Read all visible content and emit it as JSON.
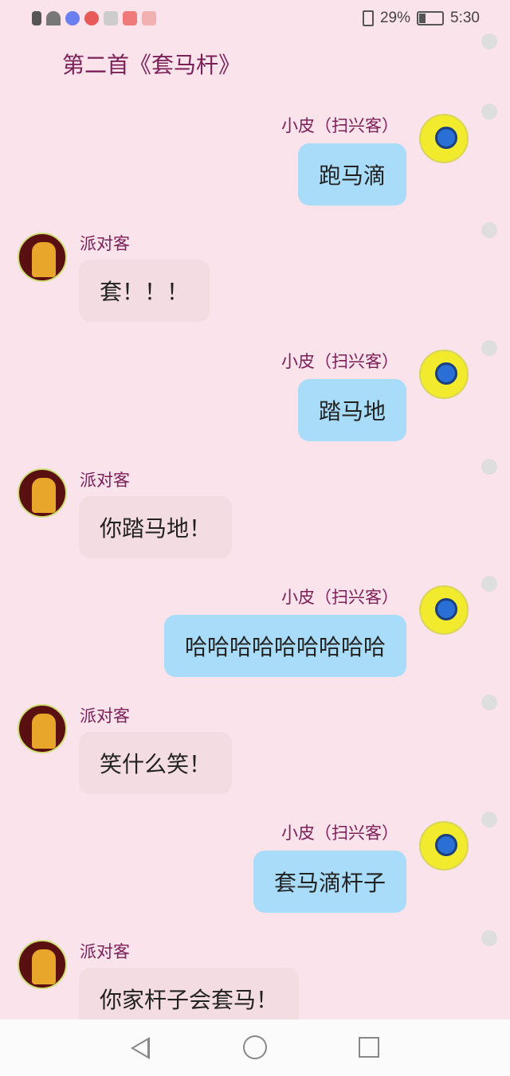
{
  "status": {
    "battery": "29%",
    "time": "5:30"
  },
  "title": "第二首《套马杆》",
  "messages": [
    {
      "sender": "小皮（扫兴客）",
      "side": "right",
      "text": "跑马滴"
    },
    {
      "sender": "派对客",
      "side": "left",
      "text": "套！！！"
    },
    {
      "sender": "小皮（扫兴客）",
      "side": "right",
      "text": "踏马地"
    },
    {
      "sender": "派对客",
      "side": "left",
      "text": "你踏马地！"
    },
    {
      "sender": "小皮（扫兴客）",
      "side": "right",
      "text": "哈哈哈哈哈哈哈哈哈"
    },
    {
      "sender": "派对客",
      "side": "left",
      "text": "笑什么笑！"
    },
    {
      "sender": "小皮（扫兴客）",
      "side": "right",
      "text": "套马滴杆子"
    },
    {
      "sender": "派对客",
      "side": "left",
      "text": "你家杆子会套马！"
    }
  ]
}
